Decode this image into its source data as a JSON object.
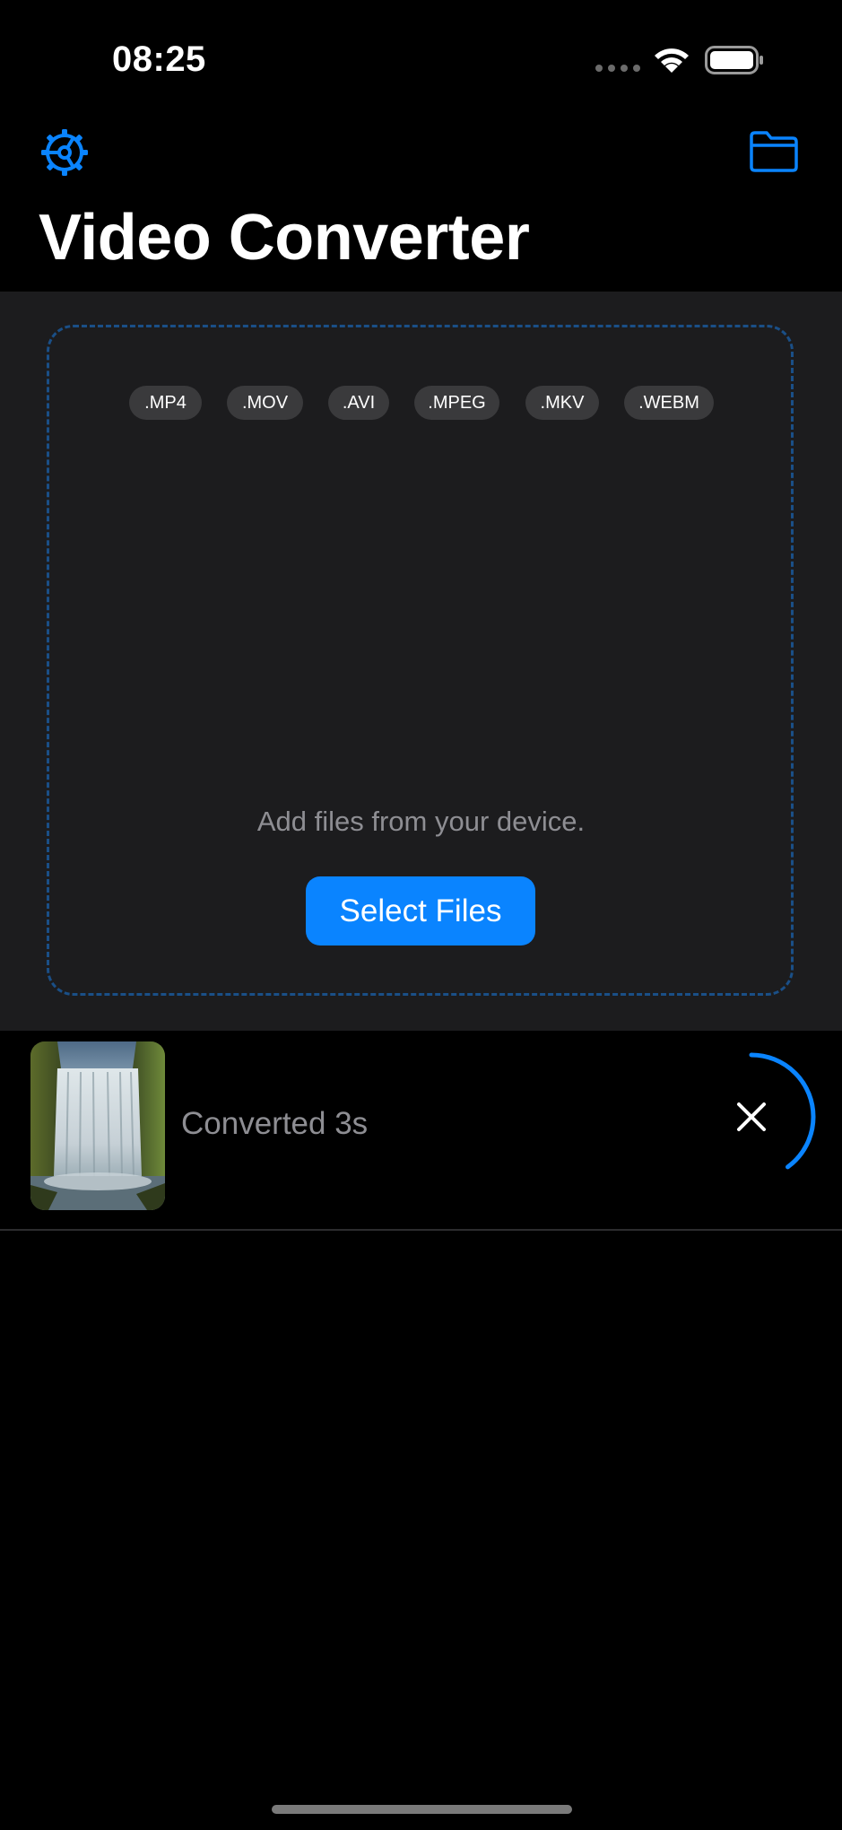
{
  "status_bar": {
    "time": "08:25"
  },
  "header": {
    "title": "Video Converter",
    "settings_icon": "gear-icon",
    "folder_icon": "folder-icon",
    "accent_color": "#0a84ff"
  },
  "drop_zone": {
    "formats": [
      ".MP4",
      ".MOV",
      ".AVI",
      ".MPEG",
      ".MKV",
      ".WEBM"
    ],
    "hint": "Add files from your device.",
    "select_button_label": "Select Files"
  },
  "files": [
    {
      "status": "Converted 3s",
      "thumbnail": "waterfall",
      "progress": 0.4
    }
  ]
}
